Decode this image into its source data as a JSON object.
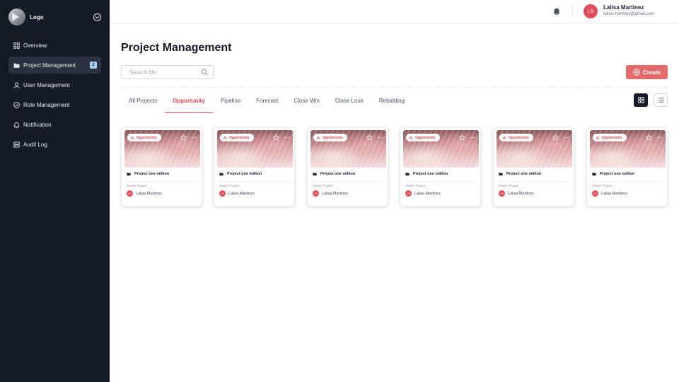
{
  "brand": {
    "name": "Logo"
  },
  "sidebar": {
    "items": [
      {
        "label": "Overview",
        "icon": "grid-icon"
      },
      {
        "label": "Project Management",
        "icon": "folder-icon",
        "badge": "2",
        "active": true
      },
      {
        "label": "User Management",
        "icon": "user-icon"
      },
      {
        "label": "Role Management",
        "icon": "shield-icon"
      },
      {
        "label": "Notification",
        "icon": "bell-icon"
      },
      {
        "label": "Audit Log",
        "icon": "server-icon"
      }
    ]
  },
  "header": {
    "user": {
      "initials": "LS",
      "name": "Lalisa Martinez",
      "email": "lalisa.martinez@gmail.com"
    }
  },
  "main": {
    "title": "Project Management",
    "search": {
      "placeholder": "Search file",
      "value": ""
    },
    "create_label": "Create",
    "tabs": [
      {
        "label": "All Projects"
      },
      {
        "label": "Opportunity",
        "active": true
      },
      {
        "label": "Pipeline"
      },
      {
        "label": "Forecast"
      },
      {
        "label": "Close Win"
      },
      {
        "label": "Close Lose"
      },
      {
        "label": "Rebidding"
      }
    ],
    "view_mode": "grid"
  },
  "cards": [
    {
      "badge": "Opportunity",
      "title": "Project one million",
      "owner_label": "Owner Project",
      "owner_initials": "LS",
      "owner_name": "Lalisa Martinez"
    },
    {
      "badge": "Opportunity",
      "title": "Project one million",
      "owner_label": "Owner Project",
      "owner_initials": "LS",
      "owner_name": "Lalisa Martinez"
    },
    {
      "badge": "Opportunity",
      "title": "Project one million",
      "owner_label": "Owner Project",
      "owner_initials": "LS",
      "owner_name": "Lalisa Martinez"
    },
    {
      "badge": "Opportunity",
      "title": "Project one million",
      "owner_label": "Owner Project",
      "owner_initials": "LS",
      "owner_name": "Lalisa Martinez"
    },
    {
      "badge": "Opportunity",
      "title": "Project one million",
      "owner_label": "Owner Project",
      "owner_initials": "LS",
      "owner_name": "Lalisa Martinez"
    },
    {
      "badge": "Opportunity",
      "title": "Project one million",
      "owner_label": "Owner Project",
      "owner_initials": "LS",
      "owner_name": "Lalisa Martinez"
    }
  ],
  "colors": {
    "sidebar_bg": "#141b26",
    "accent": "#e0464f",
    "create_button": "#e36b6b",
    "badge_bg": "#a6d4f7"
  }
}
